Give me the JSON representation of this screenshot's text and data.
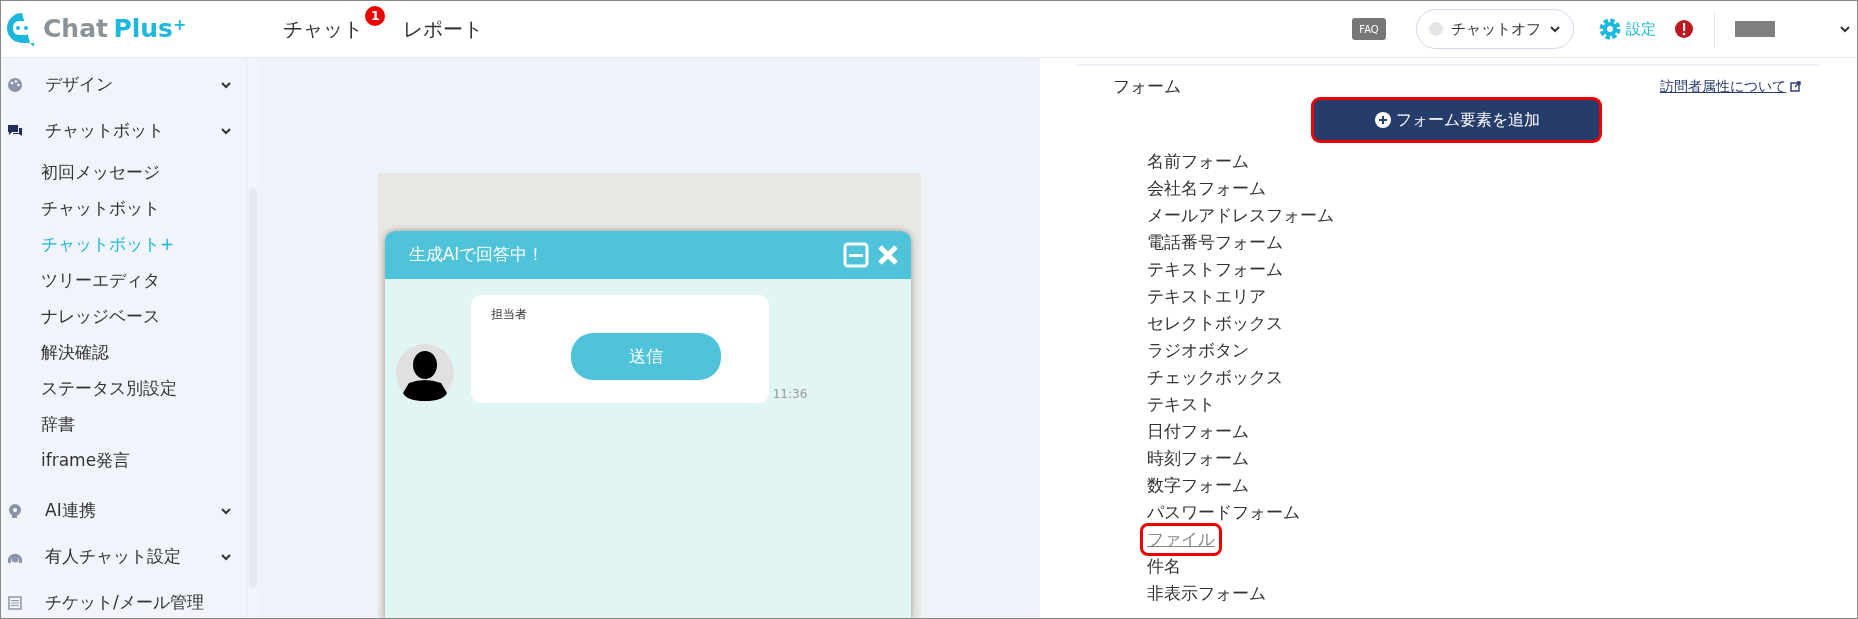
{
  "header": {
    "logo": {
      "word1": "Chat",
      "word2": "Plus",
      "mark": "+"
    },
    "nav": [
      {
        "label": "チャット",
        "badge": "1"
      },
      {
        "label": "レポート"
      }
    ],
    "faq": "FAQ",
    "chat_status": {
      "label": "チャットオフ",
      "color": "#e6e6e6"
    },
    "settings": "設定"
  },
  "sidebar": {
    "items": [
      {
        "label": "デザイン",
        "expandable": true
      },
      {
        "label": "チャットボット",
        "expandable": true,
        "children": [
          {
            "label": "初回メッセージ",
            "selected": false
          },
          {
            "label": "チャットボット",
            "selected": false
          },
          {
            "label": "チャットボット+",
            "selected": true
          },
          {
            "label": "ツリーエディタ",
            "selected": false
          },
          {
            "label": "ナレッジベース",
            "selected": false
          },
          {
            "label": "解決確認",
            "selected": false
          },
          {
            "label": "ステータス別設定",
            "selected": false
          },
          {
            "label": "辞書",
            "selected": false
          },
          {
            "label": "iframe発言",
            "selected": false
          }
        ]
      },
      {
        "label": "AI連携",
        "expandable": true
      },
      {
        "label": "有人チャット設定",
        "expandable": true
      },
      {
        "label": "チケット/メール管理",
        "expandable": false
      }
    ]
  },
  "preview": {
    "title": "生成AIで回答中！",
    "sender": "担当者",
    "button": "送信",
    "time": "11:36"
  },
  "form_panel": {
    "label": "フォーム",
    "help_link": "訪問者属性について",
    "add_button": {
      "label": "フォーム要素を追加",
      "highlighted": true
    },
    "elements": [
      {
        "label": "名前フォーム",
        "kind": "plain",
        "highlighted": false
      },
      {
        "label": "会社名フォーム",
        "kind": "plain",
        "highlighted": false
      },
      {
        "label": "メールアドレスフォーム",
        "kind": "plain",
        "highlighted": false
      },
      {
        "label": "電話番号フォーム",
        "kind": "plain",
        "highlighted": false
      },
      {
        "label": "テキストフォーム",
        "kind": "plain",
        "highlighted": false
      },
      {
        "label": "テキストエリア",
        "kind": "plain",
        "highlighted": false
      },
      {
        "label": "セレクトボックス",
        "kind": "plain",
        "highlighted": false
      },
      {
        "label": "ラジオボタン",
        "kind": "plain",
        "highlighted": false
      },
      {
        "label": "チェックボックス",
        "kind": "plain",
        "highlighted": false
      },
      {
        "label": "テキスト",
        "kind": "plain",
        "highlighted": false
      },
      {
        "label": "日付フォーム",
        "kind": "plain",
        "highlighted": false
      },
      {
        "label": "時刻フォーム",
        "kind": "plain",
        "highlighted": false
      },
      {
        "label": "数字フォーム",
        "kind": "plain",
        "highlighted": false
      },
      {
        "label": "パスワードフォーム",
        "kind": "plain",
        "highlighted": false
      },
      {
        "label": "ファイル",
        "kind": "link",
        "highlighted": true
      },
      {
        "label": "件名",
        "kind": "plain",
        "highlighted": false
      },
      {
        "label": "非表示フォーム",
        "kind": "plain",
        "highlighted": false
      }
    ]
  }
}
